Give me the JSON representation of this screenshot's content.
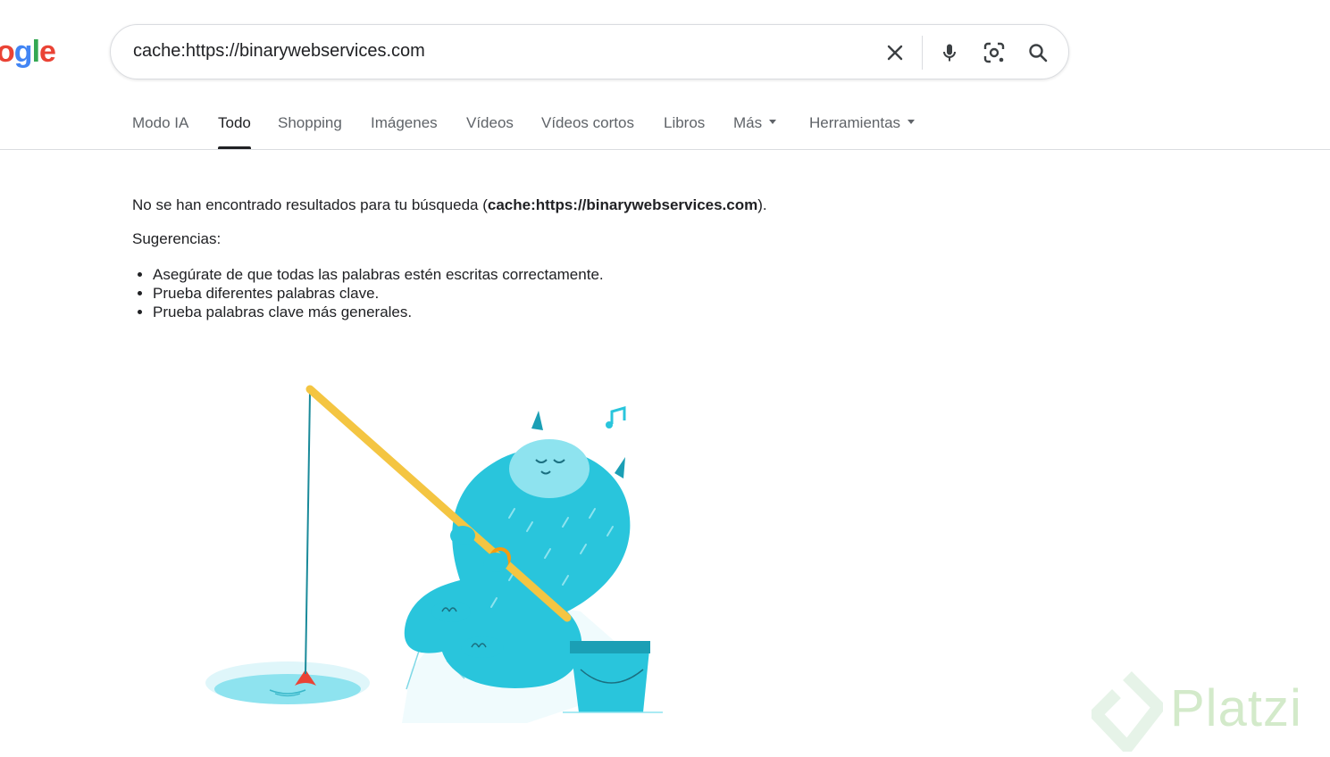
{
  "logo": {
    "letters": [
      "o",
      "g",
      "l",
      "e"
    ],
    "colors": [
      "#ea4335",
      "#4285f4",
      "#34a853",
      "#ea4335"
    ]
  },
  "search": {
    "query": "cache:https://binarywebservices.com",
    "clear_icon": "close-icon",
    "voice_icon": "microphone-icon",
    "lens_icon": "camera-lens-icon",
    "search_icon": "search-icon"
  },
  "tabs": [
    {
      "label": "Modo IA"
    },
    {
      "label": "Todo",
      "active": true
    },
    {
      "label": "Shopping"
    },
    {
      "label": "Imágenes"
    },
    {
      "label": "Vídeos"
    },
    {
      "label": "Vídeos cortos"
    },
    {
      "label": "Libros"
    },
    {
      "label": "Más"
    },
    {
      "label": "Herramientas"
    }
  ],
  "results": {
    "no_results_prefix": "No se han encontrado resultados para tu búsqueda (",
    "no_results_query": "cache:https://binarywebservices.com",
    "no_results_suffix": ").",
    "suggestions_title": "Sugerencias:",
    "suggestions": [
      "Asegúrate de que todas las palabras estén escritas correctamente.",
      "Prueba diferentes palabras clave.",
      "Prueba palabras clave más generales."
    ]
  },
  "watermark": {
    "text": "Platzi"
  },
  "colors": {
    "creature": "#29c5dc",
    "rod": "#f4c542",
    "water": "#8ee3ef",
    "bobber": "#ea4335"
  }
}
